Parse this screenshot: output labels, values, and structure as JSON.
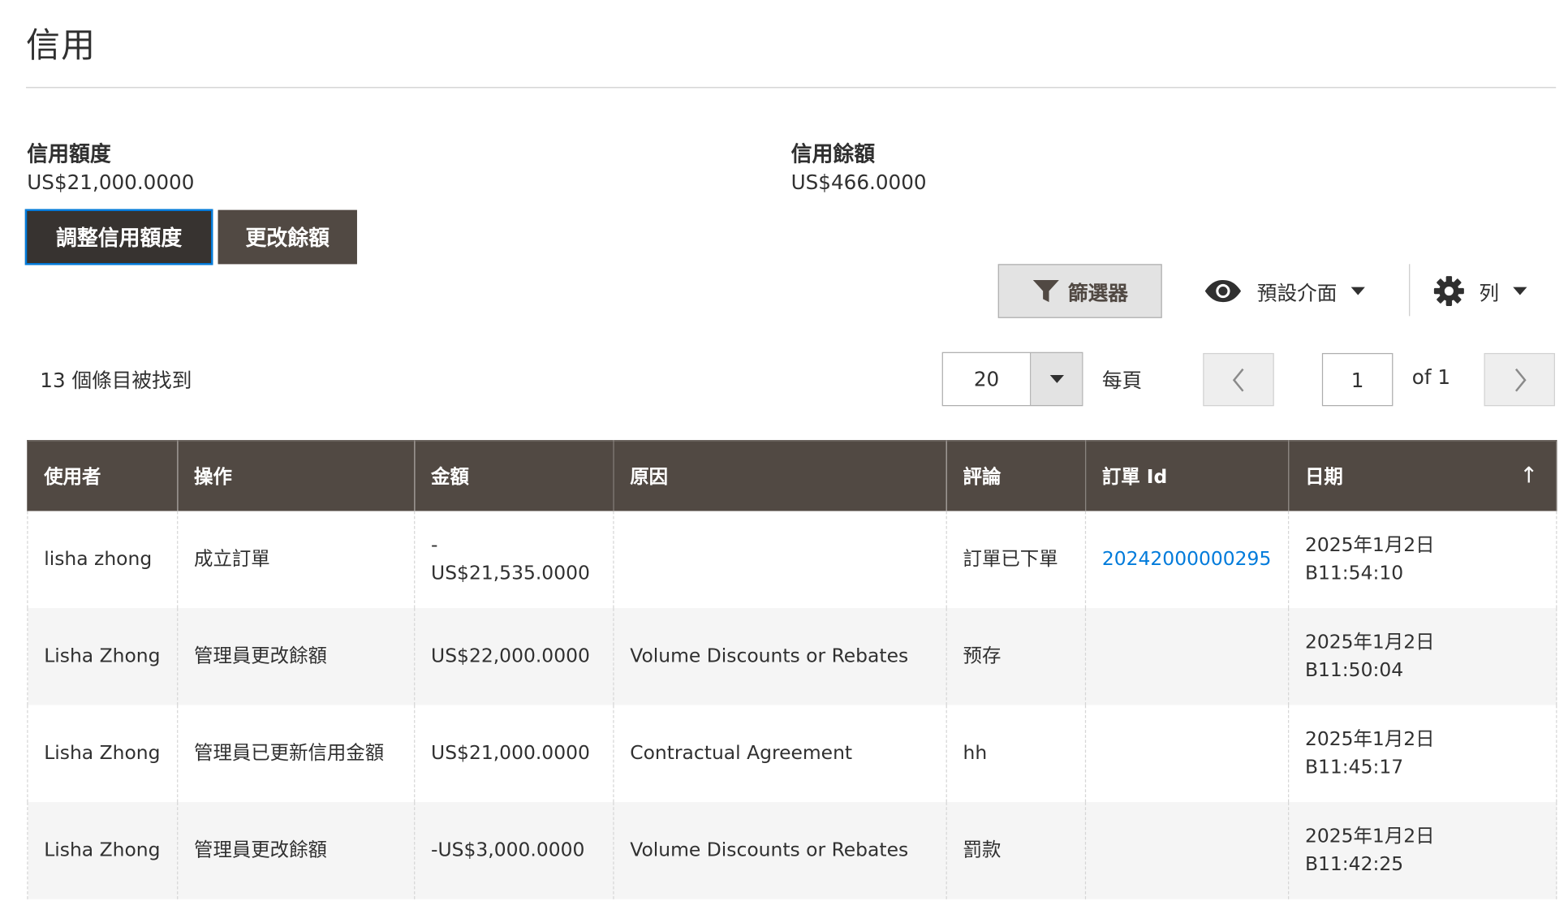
{
  "page": {
    "title": "信用"
  },
  "credit_info": {
    "limit_label": "信用額度",
    "limit_value": "US$21,000.0000",
    "balance_label": "信用餘額",
    "balance_value": "US$466.0000"
  },
  "actions": {
    "adjust_limit_label": "調整信用額度",
    "change_balance_label": "更改餘額"
  },
  "toolbar": {
    "filters_label": "篩選器",
    "view_label": "預設介面",
    "columns_label": "列"
  },
  "pager": {
    "records_found": "13 個條目被找到",
    "per_page_value": "20",
    "per_page_label": "每頁",
    "current_page": "1",
    "total_pages_label": "of 1"
  },
  "table": {
    "columns": [
      "使用者",
      "操作",
      "金額",
      "原因",
      "評論",
      "訂單 Id",
      "日期"
    ],
    "sort_indicator": "↑",
    "rows": [
      {
        "user": "lisha zhong",
        "operation": "成立訂單",
        "amount_prefix": "-",
        "amount": "US$21,535.0000",
        "reason": "",
        "comment": "訂單已下單",
        "order_id": "20242000000295",
        "date": "2025年1月2日",
        "time": "B11:54:10"
      },
      {
        "user": "Lisha Zhong",
        "operation": "管理員更改餘額",
        "amount_prefix": "",
        "amount": "US$22,000.0000",
        "reason": "Volume Discounts or Rebates",
        "comment": "预存",
        "order_id": "",
        "date": "2025年1月2日",
        "time": "B11:50:04"
      },
      {
        "user": "Lisha Zhong",
        "operation": "管理員已更新信用金額",
        "amount_prefix": "",
        "amount": "US$21,000.0000",
        "reason": "Contractual Agreement",
        "comment": "hh",
        "order_id": "",
        "date": "2025年1月2日",
        "time": "B11:45:17"
      },
      {
        "user": "Lisha Zhong",
        "operation": "管理員更改餘額",
        "amount_prefix": "",
        "amount": "-US$3,000.0000",
        "reason": "Volume Discounts or Rebates",
        "comment": "罰款",
        "order_id": "",
        "date": "2025年1月2日",
        "time": "B11:42:25"
      }
    ]
  },
  "colors": {
    "header_bg": "#514943",
    "primary_button_bg": "#514943",
    "focus_outline": "#007bdb",
    "link": "#007bdb",
    "stripe": "#f5f5f5"
  },
  "icons": {
    "filter": "filter-funnel-icon",
    "view": "eye-icon",
    "columns": "gear-icon",
    "per_page_toggle": "caret-down-icon",
    "prev": "chevron-left-icon",
    "next": "chevron-right-icon"
  }
}
